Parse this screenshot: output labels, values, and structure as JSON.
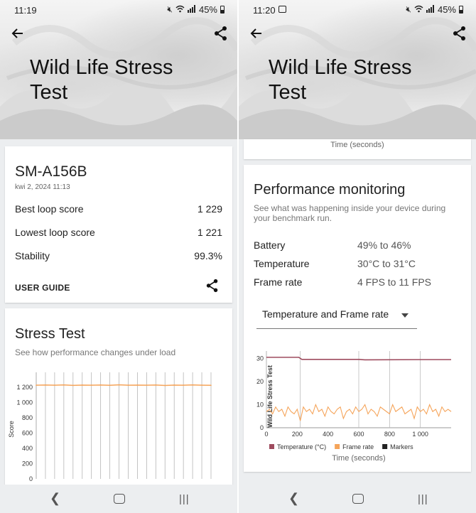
{
  "left": {
    "status": {
      "time": "11:19",
      "battery": "45%"
    },
    "title": "Wild Life Stress Test",
    "device": {
      "name": "SM-A156B",
      "date": "kwi 2, 2024 11:13",
      "rows": [
        {
          "label": "Best loop score",
          "value": "1 229"
        },
        {
          "label": "Lowest loop score",
          "value": "1 221"
        },
        {
          "label": "Stability",
          "value": "99.3%"
        }
      ],
      "user_guide": "USER GUIDE"
    },
    "stress": {
      "title": "Stress Test",
      "subtitle": "See how performance changes under load"
    }
  },
  "right": {
    "status": {
      "time": "11:20",
      "battery": "45%"
    },
    "title": "Wild Life Stress Test",
    "prev_caption": "Time (seconds)",
    "perf": {
      "title": "Performance monitoring",
      "subtitle": "See what was happening inside your device during your benchmark run.",
      "rows": [
        {
          "label": "Battery",
          "value": "49% to 46%"
        },
        {
          "label": "Temperature",
          "value": "30°C to 31°C"
        },
        {
          "label": "Frame rate",
          "value": "4 FPS to 11 FPS"
        }
      ],
      "dropdown_selected": "Temperature and Frame rate"
    }
  },
  "chart_data": [
    {
      "type": "line",
      "title": "Stress Test",
      "ylabel": "Score",
      "ylim": [
        0,
        1300
      ],
      "yticks": [
        "0",
        "200",
        "400",
        "600",
        "800",
        "1 000",
        "1 200"
      ],
      "x": [
        1,
        2,
        3,
        4,
        5,
        6,
        7,
        8,
        9,
        10,
        11,
        12,
        13,
        14,
        15,
        16,
        17,
        18,
        19,
        20
      ],
      "series": [
        {
          "values": [
            1225,
            1227,
            1224,
            1228,
            1222,
            1226,
            1225,
            1227,
            1223,
            1229,
            1224,
            1226,
            1225,
            1227,
            1221,
            1226,
            1224,
            1228,
            1225,
            1223
          ]
        }
      ],
      "colors": {
        "line": "#f5a45a",
        "grid": "#b5b5b5"
      }
    },
    {
      "type": "line",
      "xlabel": "Time (seconds)",
      "xlim": [
        0,
        1200
      ],
      "ylim": [
        0,
        32
      ],
      "xticks": [
        "0",
        "200",
        "400",
        "600",
        "800",
        "1 000"
      ],
      "yticks": [
        "0",
        "10",
        "20",
        "30"
      ],
      "marker_label": "Wild Life Stress Test",
      "markers_x": [
        0,
        220,
        600,
        800,
        1000
      ],
      "series": [
        {
          "name": "Temperature (°C)",
          "color": "#9e4b5e",
          "x": [
            0,
            210,
            230,
            600,
            640,
            1000,
            1200
          ],
          "y": [
            30.5,
            30.5,
            29.6,
            29.6,
            29.4,
            29.5,
            29.5
          ]
        },
        {
          "name": "Frame rate",
          "color": "#f5a45a",
          "x": [
            0,
            20,
            40,
            60,
            80,
            100,
            120,
            140,
            160,
            180,
            200,
            220,
            240,
            260,
            280,
            300,
            320,
            340,
            360,
            380,
            400,
            420,
            440,
            460,
            480,
            500,
            520,
            540,
            560,
            580,
            600,
            620,
            640,
            660,
            680,
            700,
            720,
            740,
            760,
            780,
            800,
            820,
            840,
            860,
            880,
            900,
            920,
            940,
            960,
            980,
            1000,
            1020,
            1040,
            1060,
            1080,
            1100,
            1120,
            1140,
            1160,
            1180,
            1200
          ],
          "y": [
            7,
            8,
            6,
            9,
            7,
            8,
            5,
            9,
            7,
            6,
            8,
            3,
            9,
            7,
            8,
            6,
            10,
            7,
            8,
            5,
            9,
            7,
            6,
            8,
            9,
            4,
            7,
            8,
            6,
            9,
            7,
            8,
            10,
            6,
            8,
            7,
            5,
            9,
            8,
            7,
            6,
            10,
            7,
            8,
            9,
            6,
            7,
            8,
            4,
            9,
            7,
            8,
            6,
            10,
            7,
            8,
            5,
            9,
            7,
            8,
            7
          ]
        }
      ],
      "legend": [
        "Temperature (°C)",
        "Frame rate",
        "Markers"
      ],
      "legend_colors": [
        "#9e4b5e",
        "#f5a45a",
        "#222222"
      ],
      "legend_position": "bottom"
    }
  ]
}
